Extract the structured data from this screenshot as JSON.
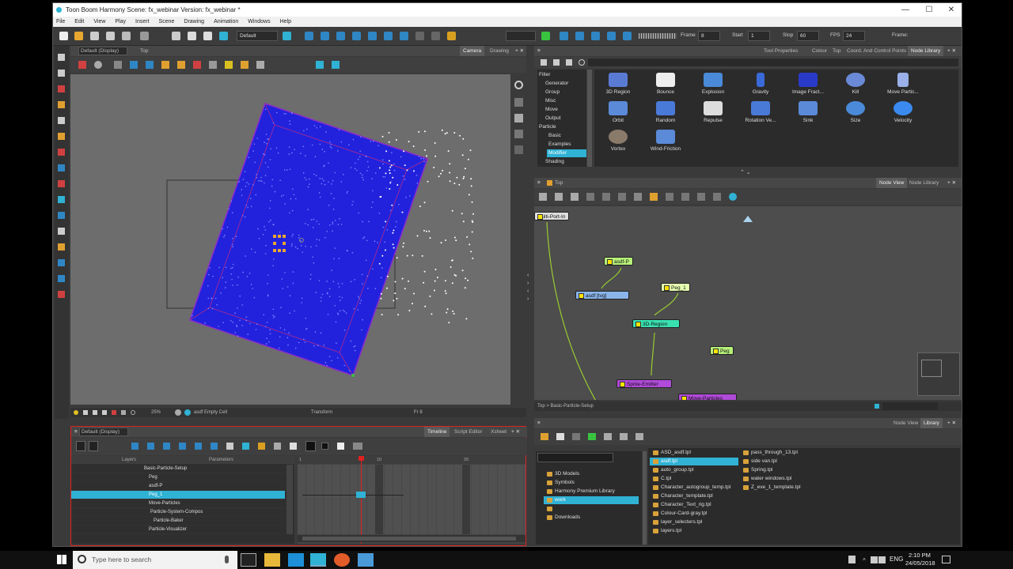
{
  "window": {
    "title": "Toon Boom Harmony Scene: fx_webinar Version: fx_webinar *",
    "controls": [
      "—",
      "☐",
      "✕"
    ]
  },
  "menu": [
    "File",
    "Edit",
    "View",
    "Play",
    "Insert",
    "Scene",
    "Drawing",
    "Animation",
    "Windows",
    "Help"
  ],
  "toolbar": {
    "workspace": "Default",
    "frame_label": "Frame",
    "frame_value": "8",
    "start_label": "Start",
    "start_value": "1",
    "stop_label": "Stop",
    "stop_value": "60",
    "fps_label": "FPS",
    "fps_value": "24",
    "frame_right_label": "Frame:"
  },
  "camera_view": {
    "display": "Default (Display)",
    "view_name": "Top",
    "tabs": [
      "Camera",
      "Drawing"
    ],
    "status_zoom": "25%",
    "status_cell": "asdf Empty Cell",
    "status_mode": "Transform",
    "status_frame": "Fr 8"
  },
  "library_top": {
    "tabs": [
      "Tool Properties",
      "Colour",
      "Top",
      "Coord. And Control Points",
      "Node Library"
    ],
    "categories": [
      "Filter",
      "Generator",
      "Group",
      "Misc",
      "Move",
      "Output",
      "Particle",
      "Basic",
      "Examples",
      "Modifier",
      "Shading"
    ],
    "selected_category": "Modifier",
    "items": [
      "3D Region",
      "Bounce",
      "Explosion",
      "Gravity",
      "Image Fract...",
      "Kill",
      "Move Partic...",
      "Orbit",
      "Random",
      "Repulse",
      "Rotation Ve...",
      "Sink",
      "Size",
      "Velocity",
      "Vortex",
      "Wind-Friction"
    ]
  },
  "node_view": {
    "view_name": "Top",
    "tabs": [
      "Node View",
      "Node Library"
    ],
    "nodes": [
      "Multi-Port-In",
      "asdf-P",
      "asdf [tvg]",
      "Peg_1",
      "3D-Region",
      "Peg",
      "Sprite-Emitter",
      "Move-Particles"
    ],
    "breadcrumb": "Top > Basic-Particle-Setup"
  },
  "timeline": {
    "display": "Default (Display)",
    "tabs": [
      "Timeline",
      "Script Editor",
      "Xsheet"
    ],
    "headers": [
      "Layers",
      "Parameters"
    ],
    "layers": [
      "Basic-Particle-Setup",
      "Peg",
      "asdf-P",
      "Peg_1",
      "Move-Particles",
      "Particle-System-Compos",
      "Particle-Baker",
      "Particle-Visualizer"
    ],
    "frame_marks": [
      "1",
      "10",
      "20"
    ]
  },
  "library_bottom": {
    "tabs": [
      "Node View",
      "Library"
    ],
    "tree": [
      "3D Models",
      "Symbols",
      "Harmony Premium Library",
      "work",
      "",
      "Downloads"
    ],
    "files_col1": [
      "ASD_asdf.tpl",
      "asdf.tpl",
      "auto_group.tpl",
      "C.tpl",
      "Character_autogroup_temp.tpl",
      "Character_template.tpl",
      "Character_Text_rig.tpl",
      "Colour-Card-gray.tpl",
      "layer_selecters.tpl",
      "layers.tpl"
    ],
    "files_col2": [
      "pass_through_13.tpl",
      "side van.tpl",
      "Spring.tpl",
      "water windows.tpl",
      "Z_eve_1_template.tpl"
    ]
  },
  "taskbar": {
    "search_placeholder": "Type here to search",
    "lang": "ENG",
    "time": "2:10 PM",
    "date": "24/05/2018"
  },
  "colors": {
    "accent": "#2fb2d4",
    "region_blue": "#2222dd",
    "node_green": "#b6f07a",
    "node_purple": "#b04ad8",
    "node_cyan": "#39e0b0"
  }
}
